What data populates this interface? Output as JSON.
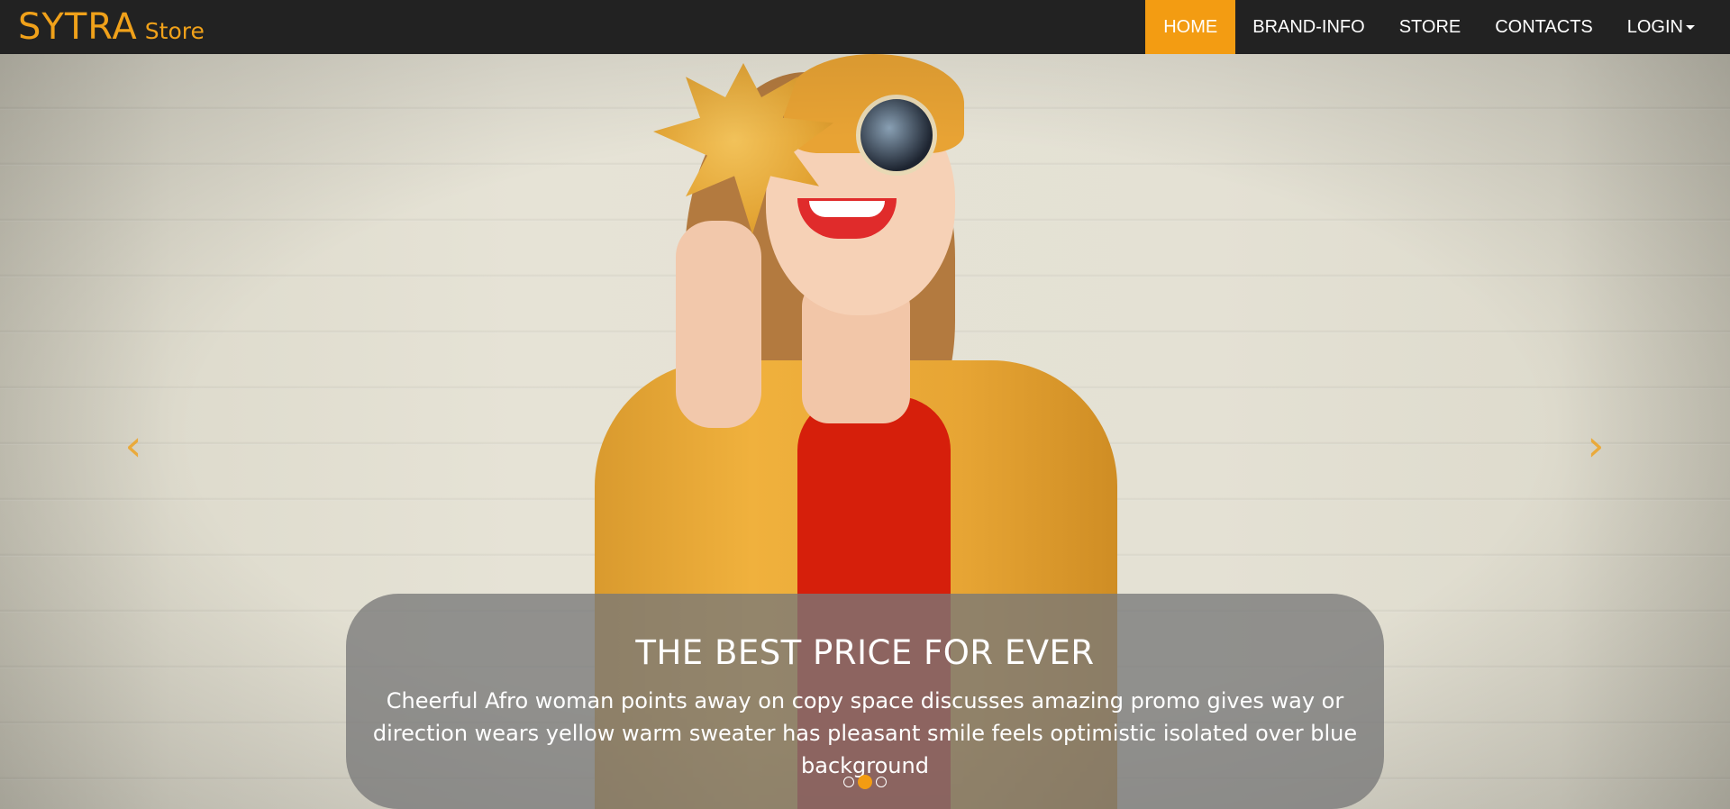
{
  "brand": {
    "main": "SYTRA",
    "sub": "Store"
  },
  "nav": {
    "items": [
      {
        "label": "HOME",
        "active": true
      },
      {
        "label": "BRAND-INFO"
      },
      {
        "label": "STORE"
      },
      {
        "label": "CONTACTS"
      },
      {
        "label": "LOGIN"
      }
    ]
  },
  "carousel": {
    "prev_icon": "chevron-left-icon",
    "next_icon": "chevron-right-icon",
    "prev_glyph": "‹",
    "next_glyph": "›",
    "caption_title": "THE BEST PRICE FOR EVER",
    "caption_text": "Cheerful Afro woman points away on copy space discusses amazing promo gives way or direction wears yellow warm sweater has pleasant smile feels optimistic isolated over blue background",
    "active_slide": 2,
    "slide_count": 3
  },
  "colors": {
    "accent": "#f39c12",
    "navbar_bg": "#222222",
    "brand": "#f0a11a"
  }
}
